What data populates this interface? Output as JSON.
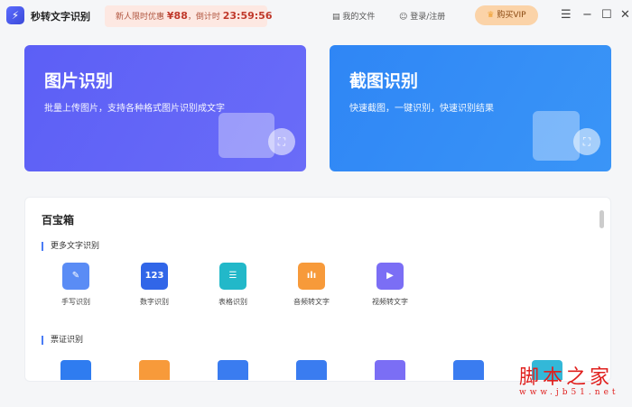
{
  "app": {
    "name": "秒转文字识别",
    "logo_icon": "lightning-icon"
  },
  "promo": {
    "text": "新人限时优惠",
    "price": "¥88",
    "countdown_label": "，倒计时",
    "countdown": "23:59:56"
  },
  "toolbar": {
    "files": "我的文件",
    "login": "登录/注册",
    "vip": "购买VIP"
  },
  "cards": [
    {
      "title": "图片识别",
      "desc": "批量上传图片，支持各种格式图片识别成文字",
      "color": "#5b5cf5"
    },
    {
      "title": "截图识别",
      "desc": "快速截图，一键识别，快速识别结果",
      "color": "#2f8cf5"
    }
  ],
  "toolbox": {
    "title": "百宝箱",
    "sections": [
      {
        "label": "更多文字识别",
        "items": [
          {
            "label": "手写识别",
            "glyph": "✎",
            "color": "#5a8cf5"
          },
          {
            "label": "数字识别",
            "glyph": "123",
            "color": "#3166e8"
          },
          {
            "label": "表格识别",
            "glyph": "☰",
            "color": "#22b8c9"
          },
          {
            "label": "音频转文字",
            "glyph": "ılı",
            "color": "#f79a3a"
          },
          {
            "label": "视频转文字",
            "glyph": "▶",
            "color": "#7b6ef5"
          }
        ]
      },
      {
        "label": "票证识别",
        "colors": [
          "#2f7cf0",
          "#f79a3a",
          "#3a7cf0",
          "#3a7cf0",
          "#7b6ef5",
          "#3a7cf0",
          "#33b8d8"
        ]
      }
    ]
  },
  "watermark": {
    "cn": "脚本之家",
    "url": "www.jb51.net"
  }
}
